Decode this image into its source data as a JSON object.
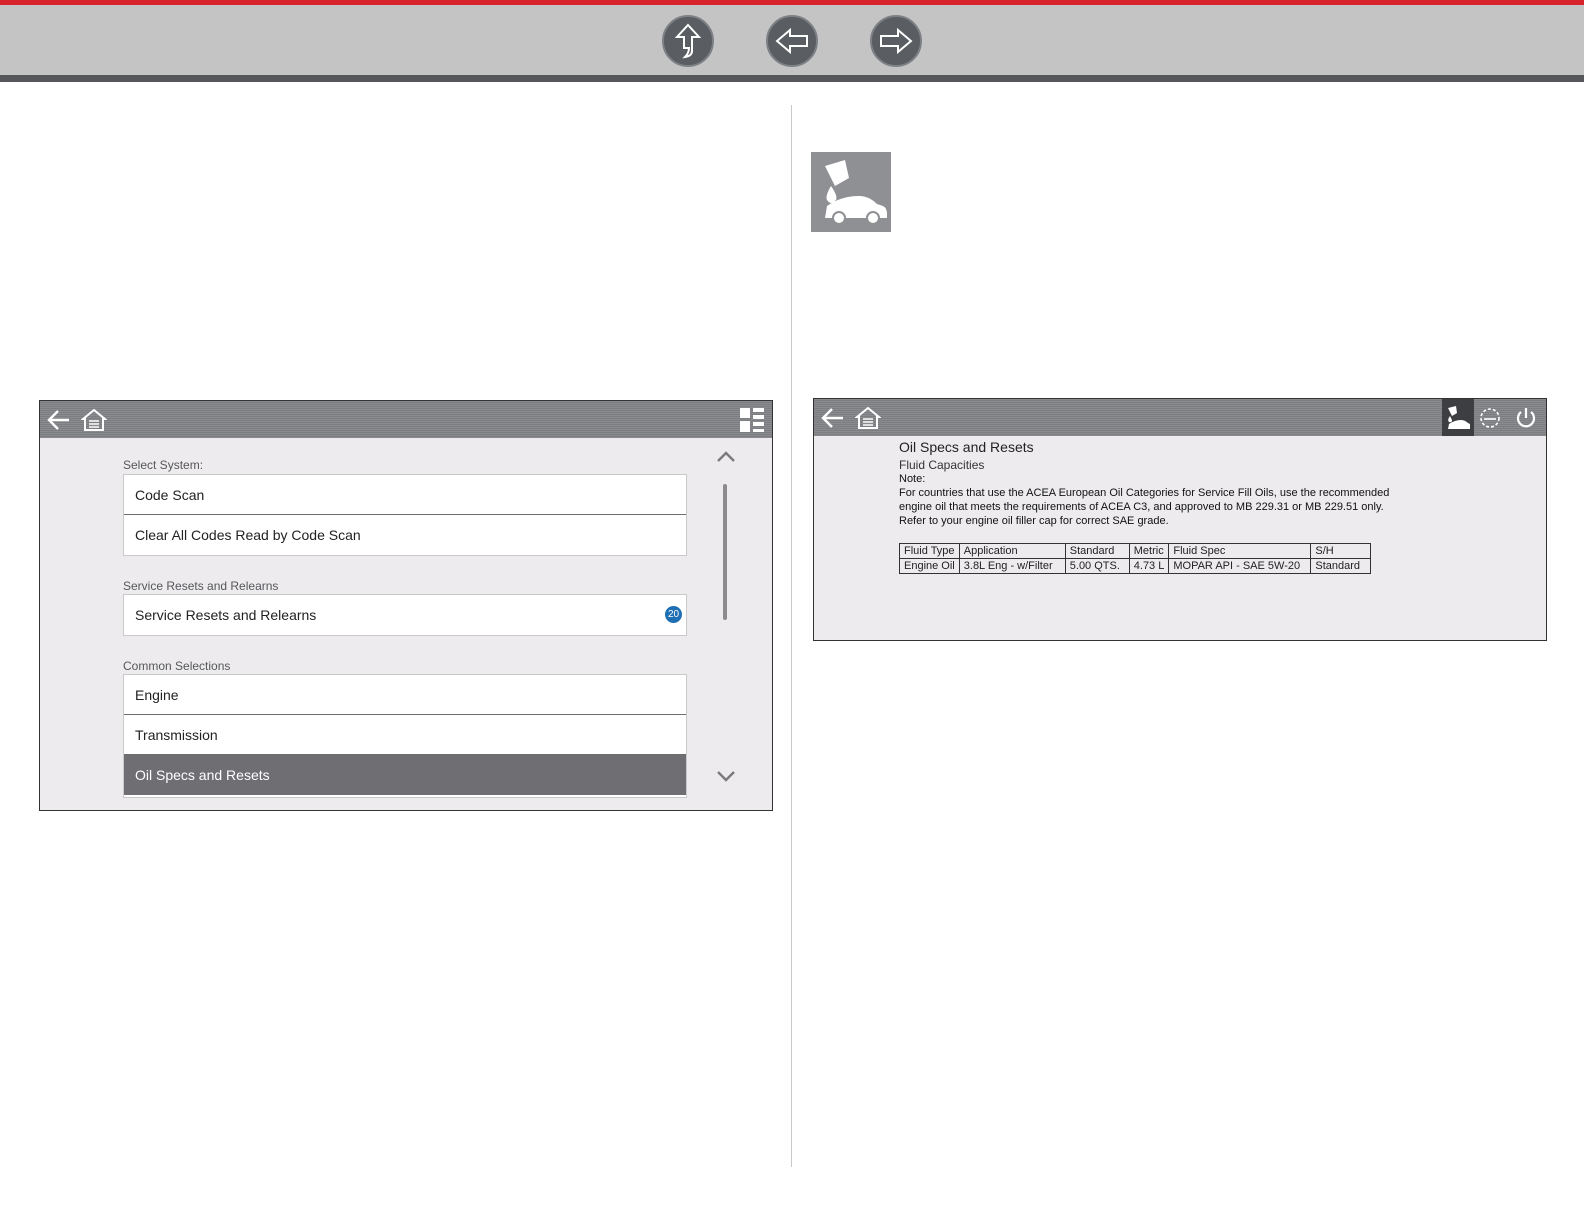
{
  "nav": {
    "up_icon": "up-arrow-icon",
    "back_icon": "left-arrow-icon",
    "forward_icon": "right-arrow-icon"
  },
  "left_screen": {
    "header_icons": [
      "back-arrow-icon",
      "home-icon",
      "view-toggle-icon"
    ],
    "sections": {
      "select_system": {
        "label": "Select System:",
        "items": [
          "Code Scan",
          "Clear All Codes Read by Code Scan"
        ]
      },
      "service_resets": {
        "label": "Service Resets and Relearns",
        "items": [
          "Service Resets and Relearns"
        ],
        "badge": "20"
      },
      "common_selections": {
        "label": "Common Selections",
        "items": [
          "Engine",
          "Transmission",
          "Oil Specs and Resets"
        ],
        "selected": "Oil Specs and Resets"
      }
    }
  },
  "right_screen": {
    "header_icons": [
      "back-arrow-icon",
      "home-icon",
      "oil-car-icon",
      "vehicle-icon",
      "power-icon"
    ],
    "title": "Oil Specs and Resets",
    "subtitle": "Fluid Capacities",
    "note_label": "Note:",
    "note_lines": [
      "For countries that use the ACEA European Oil Categories for Service Fill Oils, use the recommended",
      "engine oil that meets the requirements of ACEA C3, and approved to MB 229.31 or MB 229.51 only.",
      "Refer to your engine oil filler cap for correct SAE grade."
    ],
    "table": {
      "headers": [
        "Fluid Type",
        "Application",
        "Standard",
        "Metric",
        "Fluid Spec",
        "S/H"
      ],
      "rows": [
        [
          "Engine Oil",
          "3.8L Eng - w/Filter",
          "5.00 QTS.",
          "4.73 L",
          "MOPAR API - SAE 5W-20",
          "Standard"
        ]
      ]
    }
  },
  "colors": {
    "accent_red": "#d8232a",
    "badge_blue": "#1f6fb4",
    "selected_row": "#6f6e73"
  }
}
